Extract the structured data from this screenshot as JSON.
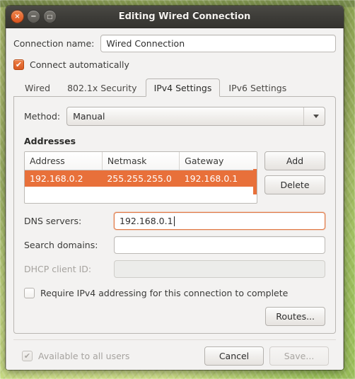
{
  "window": {
    "title": "Editing Wired Connection",
    "controls": [
      {
        "name": "close",
        "glyph": "×"
      },
      {
        "name": "minimize",
        "glyph": "−"
      },
      {
        "name": "maximize",
        "glyph": "□"
      }
    ]
  },
  "connection": {
    "name_label": "Connection name:",
    "name_value": "Wired Connection",
    "autoconnect_label": "Connect automatically",
    "autoconnect_checked": true
  },
  "tabs": [
    {
      "label": "Wired",
      "active": false
    },
    {
      "label": "802.1x Security",
      "active": false
    },
    {
      "label": "IPv4 Settings",
      "active": true
    },
    {
      "label": "IPv6 Settings",
      "active": false
    }
  ],
  "ipv4": {
    "method_label": "Method:",
    "method_value": "Manual",
    "addresses_title": "Addresses",
    "table": {
      "columns": [
        "Address",
        "Netmask",
        "Gateway"
      ],
      "rows": [
        {
          "cells": [
            "192.168.0.2",
            "255.255.255.0",
            "192.168.0.1"
          ],
          "selected": true
        }
      ]
    },
    "add_label": "Add",
    "delete_label": "Delete",
    "dns_label": "DNS servers:",
    "dns_value": "192.168.0.1",
    "search_label": "Search domains:",
    "search_value": "",
    "dhcp_label": "DHCP client ID:",
    "dhcp_value": "",
    "require_label": "Require IPv4 addressing for this connection to complete",
    "require_checked": false,
    "routes_label": "Routes..."
  },
  "footer": {
    "all_users_label": "Available to all users",
    "all_users_checked": true,
    "cancel_label": "Cancel",
    "save_label": "Save..."
  },
  "colors": {
    "accent_orange": "#e8703a",
    "titlebar": "#3d3c38",
    "dialog_bg": "#f3f2f1"
  },
  "glyphs": {
    "check": "✔"
  }
}
